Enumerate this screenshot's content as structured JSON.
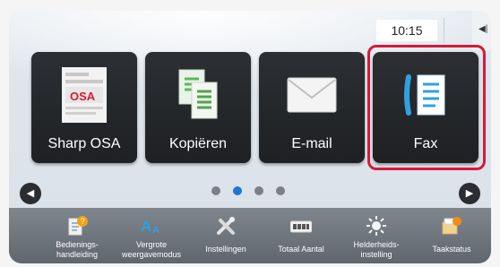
{
  "status": {
    "time": "10:15",
    "side_tab_glyph": "◀|"
  },
  "tiles": [
    {
      "label": "Sharp OSA",
      "icon": "sharp-osa-icon"
    },
    {
      "label": "Kopiëren",
      "icon": "copy-icon"
    },
    {
      "label": "E-mail",
      "icon": "mail-icon"
    },
    {
      "label": "Fax",
      "icon": "fax-icon"
    }
  ],
  "pager": {
    "page_count": 4,
    "active_page": 2
  },
  "bottom": {
    "items": [
      {
        "label": "Bedienings-\nhandleiding",
        "icon": "manual-icon"
      },
      {
        "label": "Vergrote\nweergavemodus",
        "icon": "enlarge-text-icon"
      },
      {
        "label": "Instellingen",
        "icon": "tools-icon"
      },
      {
        "label": "Totaal Aantal",
        "icon": "counter-icon"
      },
      {
        "label": "Helderheids-\ninstelling",
        "icon": "brightness-icon"
      },
      {
        "label": "Taakstatus",
        "icon": "job-status-icon"
      }
    ]
  },
  "colors": {
    "highlight": "#d51a3a",
    "active_dot": "#1e77d0",
    "tile_bg": "#2c2f33"
  },
  "osa_icon_text": "OSA"
}
